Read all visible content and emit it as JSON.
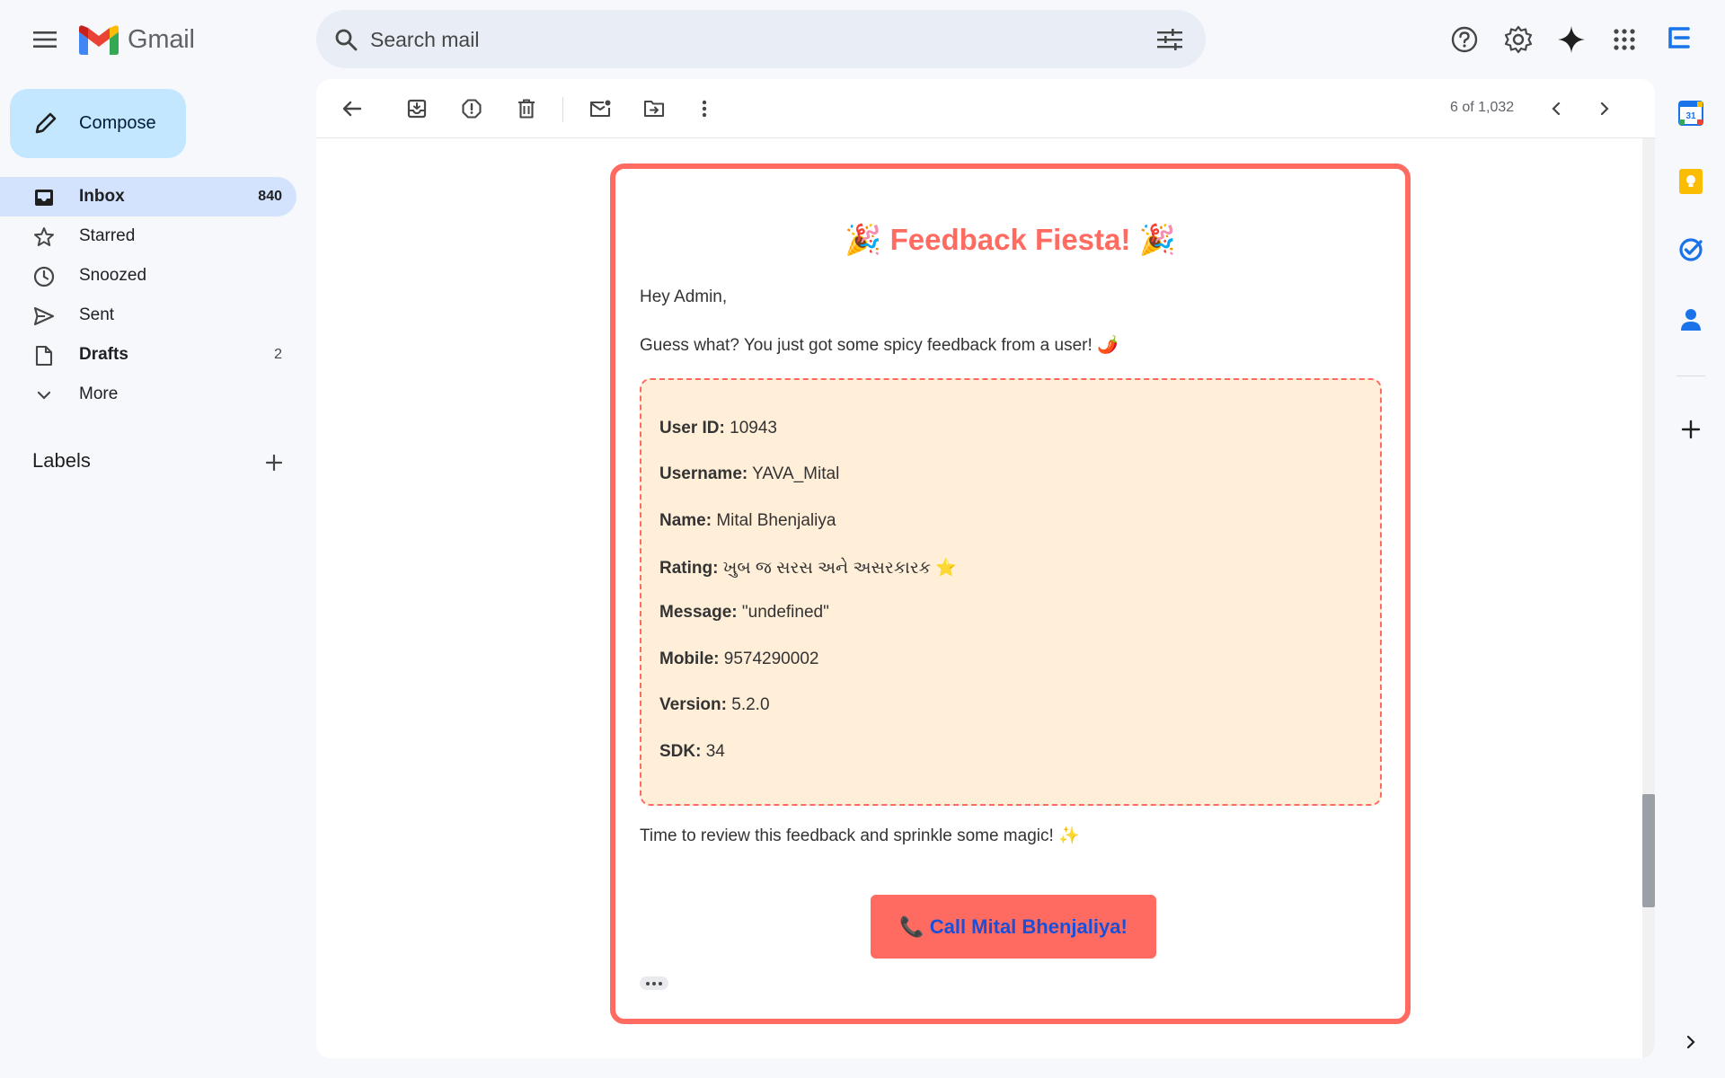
{
  "app": {
    "name": "Gmail"
  },
  "search": {
    "placeholder": "Search mail"
  },
  "compose": {
    "label": "Compose"
  },
  "nav": {
    "items": [
      {
        "label": "Inbox",
        "count": "840"
      },
      {
        "label": "Starred",
        "count": ""
      },
      {
        "label": "Snoozed",
        "count": ""
      },
      {
        "label": "Sent",
        "count": ""
      },
      {
        "label": "Drafts",
        "count": "2"
      },
      {
        "label": "More",
        "count": ""
      }
    ]
  },
  "labels": {
    "heading": "Labels"
  },
  "toolbar": {
    "pager": "6 of 1,032"
  },
  "email": {
    "title": "🎉 Feedback Fiesta! 🎉",
    "greeting": "Hey Admin,",
    "intro": "Guess what? You just got some spicy feedback from a user! 🌶️",
    "fields": [
      {
        "key": "User ID:",
        "value": "10943"
      },
      {
        "key": "Username:",
        "value": "YAVA_Mital"
      },
      {
        "key": "Name:",
        "value": "Mital Bhenjaliya"
      },
      {
        "key": "Rating:",
        "value": "ખુબ જ સરસ અને અસરકારક ⭐"
      },
      {
        "key": "Message:",
        "value": "\"undefined\""
      },
      {
        "key": "Mobile:",
        "value": "9574290002"
      },
      {
        "key": "Version:",
        "value": "5.2.0"
      },
      {
        "key": "SDK:",
        "value": "34"
      }
    ],
    "outro": "Time to review this feedback and sprinkle some magic! ✨",
    "cta": "📞 Call Mital Bhenjaliya!"
  },
  "colors": {
    "accent": "#ff6b61",
    "details_bg": "#ffeed8",
    "cta_text": "#1a4fd6",
    "compose_bg": "#c2e7ff",
    "nav_active": "#d3e3fd"
  }
}
